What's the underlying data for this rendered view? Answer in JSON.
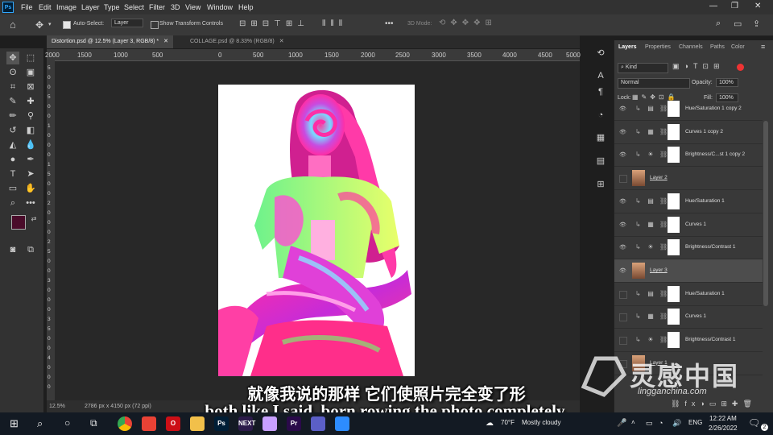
{
  "menubar": {
    "app_icon": "Ps",
    "items": [
      "File",
      "Edit",
      "Image",
      "Layer",
      "Type",
      "Select",
      "Filter",
      "3D",
      "View",
      "Window",
      "Help"
    ],
    "window_controls": [
      "—",
      "❐",
      "✕"
    ]
  },
  "options": {
    "auto_select_label": "Auto-Select:",
    "auto_select_target": "Layer",
    "show_transform_label": "Show Transform Controls",
    "mode_3d_label": "3D Mode:",
    "more": "•••"
  },
  "tabs": [
    {
      "label": "Distortion.psd @ 12.5% (Layer 3, RGB/8) *",
      "close": "✕"
    },
    {
      "label": "COLLAGE.psd @ 8.33% (RGB/8)",
      "close": "✕"
    }
  ],
  "ruler": {
    "h_ticks": [
      "2000",
      "1500",
      "1000",
      "500",
      "0",
      "500",
      "1000",
      "1500",
      "2000",
      "2500",
      "3000",
      "3500",
      "4000",
      "4500",
      "5000"
    ],
    "v_ticks": [
      "5",
      "0",
      "0",
      "5",
      "0",
      "0",
      "1",
      "0",
      "0",
      "0",
      "1",
      "5",
      "0",
      "0",
      "2",
      "0",
      "0",
      "0",
      "2",
      "5",
      "0",
      "0",
      "3",
      "0",
      "0",
      "0",
      "3",
      "5",
      "0",
      "0",
      "4",
      "0",
      "0",
      "0"
    ]
  },
  "status": {
    "zoom": "12.5%",
    "doc_info": "2786 px x 4150 px (72 ppi)"
  },
  "panel": {
    "tabs": [
      "Layers",
      "Properties",
      "Channels",
      "Paths",
      "Color"
    ],
    "kind_label": "Kind",
    "blend_mode": "Normal",
    "opacity_label": "Opacity:",
    "opacity_value": "100%",
    "lock_label": "Lock:",
    "fill_label": "Fill:",
    "fill_value": "100%",
    "layers": [
      {
        "name": "Hue/Saturation 1 copy 2",
        "type": "adj",
        "icon": "▤",
        "visible": true
      },
      {
        "name": "Curves 1 copy 2",
        "type": "adj",
        "icon": "▦",
        "visible": true
      },
      {
        "name": "Brightness/C...st 1 copy 2",
        "type": "adj",
        "icon": "☀",
        "visible": true
      },
      {
        "name": "Layer 2",
        "type": "image",
        "icon": "",
        "visible": false
      },
      {
        "name": "Hue/Saturation 1",
        "type": "adj",
        "icon": "▤",
        "visible": true
      },
      {
        "name": "Curves 1",
        "type": "adj",
        "icon": "▦",
        "visible": true
      },
      {
        "name": "Brightness/Contrast 1",
        "type": "adj",
        "icon": "☀",
        "visible": true
      },
      {
        "name": "Layer 3",
        "type": "image",
        "icon": "",
        "visible": true,
        "selected": true
      },
      {
        "name": "Hue/Saturation 1",
        "type": "adj",
        "icon": "▤",
        "visible": false
      },
      {
        "name": "Curves 1",
        "type": "adj",
        "icon": "▦",
        "visible": false
      },
      {
        "name": "Brightness/Contrast 1",
        "type": "adj",
        "icon": "☀",
        "visible": false
      },
      {
        "name": "Layer 1",
        "type": "image",
        "icon": "",
        "visible": false
      }
    ]
  },
  "taskbar": {
    "weather_temp": "70°F",
    "weather_desc": "Mostly cloudy",
    "lang": "ENG",
    "time": "12:22 AM",
    "date": "2/26/2022",
    "notif_count": "2",
    "apps": [
      {
        "label": "",
        "color": "#ffffff"
      },
      {
        "label": "",
        "color": "#e94235"
      },
      {
        "label": "O",
        "color": "#cc0f16"
      },
      {
        "label": "",
        "color": "#f2c04a"
      },
      {
        "label": "Ps",
        "color": "#001e36"
      },
      {
        "label": "NEXT",
        "color": "#2c1b4a"
      },
      {
        "label": "",
        "color": "#c8a0ff"
      },
      {
        "label": "Pr",
        "color": "#2a0a4a"
      },
      {
        "label": "",
        "color": "#5b5fc7"
      },
      {
        "label": "",
        "color": "#2d8cff"
      }
    ]
  },
  "subtitles": {
    "cn": "就像我说的那样 它们使照片完全变了形",
    "en": "both like I said, born rowing the photo completely."
  },
  "watermark": {
    "brand_cn": "灵感中国",
    "url": "lingganchina.com"
  },
  "colors": {
    "foreground": "#4a0c2a",
    "background": "#000000"
  }
}
